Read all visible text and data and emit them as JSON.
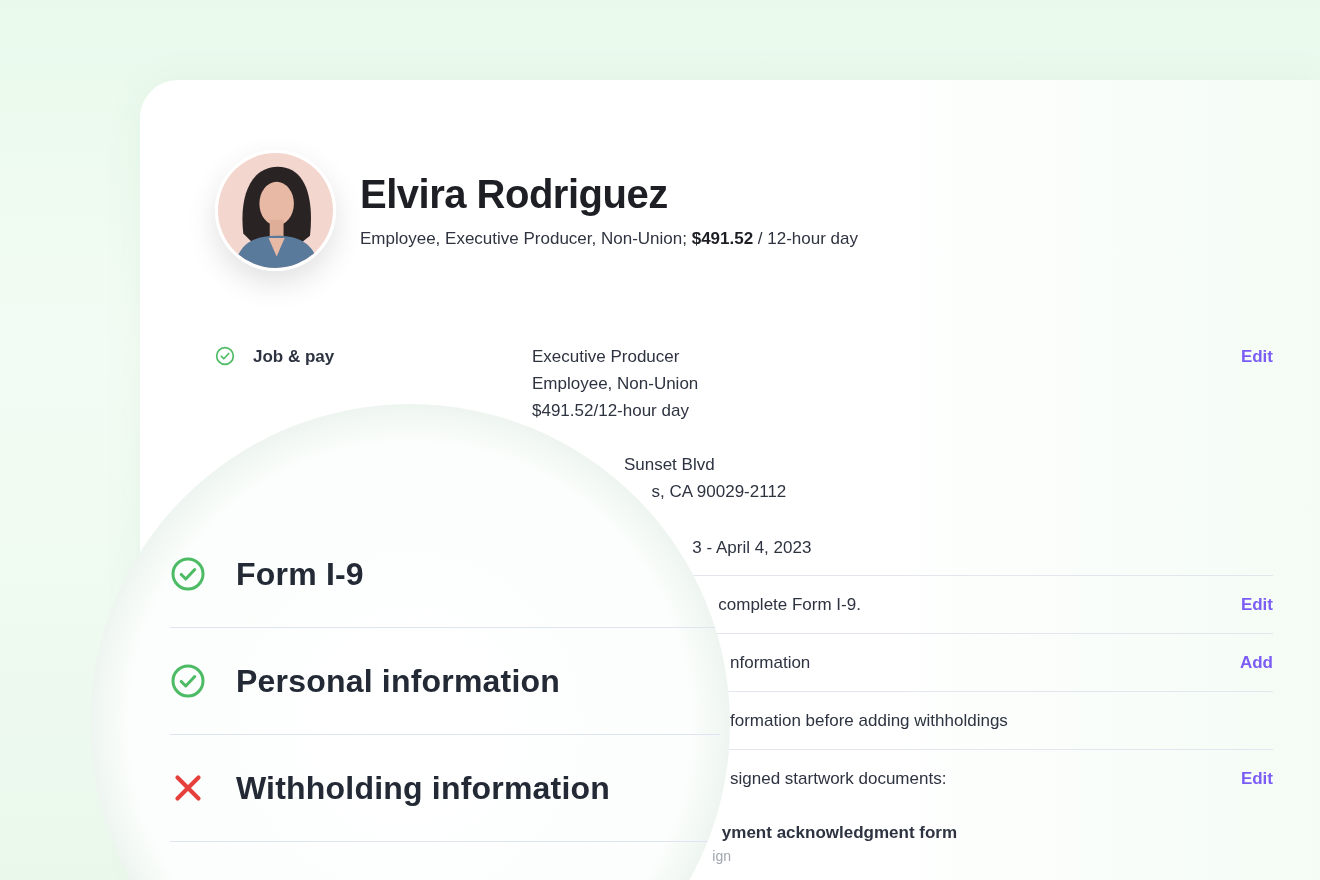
{
  "profile": {
    "name": "Elvira Rodriguez",
    "summary": "Employee, Executive Producer, Non-Union; **$491.52** / 12-hour day"
  },
  "job_pay": {
    "label": "Job & pay",
    "complete": true,
    "details": [
      "Executive Producer",
      "Employee, Non-Union",
      "$491.52/12-hour day"
    ],
    "action": "Edit"
  },
  "magnifier": {
    "items": [
      {
        "label": "Form I-9",
        "complete": true
      },
      {
        "label": "Personal information",
        "complete": true
      },
      {
        "label": "Withholding information",
        "complete": false
      }
    ]
  },
  "rows": [
    {
      "kind": "text",
      "divider": false,
      "lines": [
        "Sunset Blvd",
        "s, CA 90029-2112"
      ]
    },
    {
      "kind": "text",
      "divider": false,
      "lines": [
        "3 - April 4, 2023"
      ]
    },
    {
      "kind": "text",
      "divider": true,
      "lines": [
        "complete Form I-9."
      ],
      "action": "Edit"
    },
    {
      "kind": "text",
      "divider": true,
      "lines": [
        "nformation"
      ],
      "action": "Add"
    },
    {
      "kind": "text",
      "divider": true,
      "lines": [
        "formation before adding withholdings"
      ]
    },
    {
      "kind": "text",
      "divider": true,
      "lines": [
        "signed startwork documents:"
      ],
      "action": "Edit"
    },
    {
      "kind": "strong",
      "divider": false,
      "lines": [
        "yment acknowledgment form"
      ]
    },
    {
      "kind": "note",
      "divider": false,
      "lines": [
        "ign"
      ]
    }
  ]
}
